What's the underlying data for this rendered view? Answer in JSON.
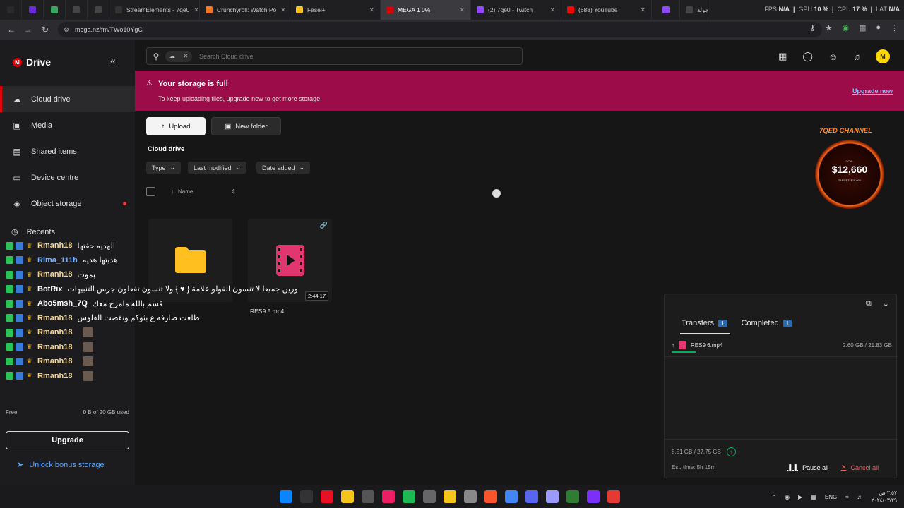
{
  "browser": {
    "tabs": [
      {
        "label": "",
        "color": "#2a2a2a"
      },
      {
        "label": "",
        "color": "#6b2bd6"
      },
      {
        "label": "",
        "color": "#3aa55c"
      },
      {
        "label": "",
        "color": "#444"
      },
      {
        "label": "",
        "color": "#444"
      },
      {
        "label": "StreamElements - 7qe0",
        "color": "#333"
      },
      {
        "label": "Crunchyroll: Watch Po",
        "color": "#f47521"
      },
      {
        "label": "Fasel+",
        "color": "#f5c518"
      },
      {
        "label": "MEGA 1 0%",
        "color": "#d90007"
      },
      {
        "label": "(2) 7qe0 - Twitch",
        "color": "#9146ff"
      },
      {
        "label": "(688) YouTube",
        "color": "#ff0000"
      },
      {
        "label": "",
        "color": "#9146ff"
      },
      {
        "label": "سرد | جولة",
        "color": "#444"
      }
    ],
    "perf": {
      "fps_label": "FPS",
      "fps": "N/A",
      "gpu_label": "GPU",
      "gpu": "10 %",
      "cpu_label": "CPU",
      "cpu": "17 %",
      "lat_label": "LAT",
      "lat": "N/A"
    },
    "url": "mega.nz/fm/TWo10YgC"
  },
  "sidebar": {
    "brand": "Drive",
    "items": [
      {
        "label": "Cloud drive",
        "icon": "cloud-icon"
      },
      {
        "label": "Media",
        "icon": "image-icon"
      },
      {
        "label": "Shared items",
        "icon": "shared-icon"
      },
      {
        "label": "Device centre",
        "icon": "monitor-icon"
      },
      {
        "label": "Object storage",
        "icon": "object-storage-icon"
      }
    ],
    "recents": "Recents",
    "storage_label": "Free",
    "storage_used": "0 B of 20 GB used",
    "upgrade": "Upgrade",
    "unlock": "Unlock bonus storage"
  },
  "chat": [
    {
      "name": "Rmanh18",
      "msg": "الهديه حقتها",
      "style": ""
    },
    {
      "name": "Rima_111h",
      "msg": "هديتها هديه",
      "style": "blue"
    },
    {
      "name": "Rmanh18",
      "msg": "بموت",
      "style": ""
    },
    {
      "name": "BotRix",
      "msg": "ورين جميعا لا تنسون الفولو علامة { ♥ } ولا تنسون تفعلون جرس التنبيهات",
      "style": "white"
    },
    {
      "name": "Abo5msh_7Q",
      "msg": "قسم بالله مامزح معك",
      "style": "white"
    },
    {
      "name": "Rmanh18",
      "msg": "طلعت صارفه ع بثوكم ونقصت الفلوس",
      "style": ""
    },
    {
      "name": "Rmanh18",
      "msg": "",
      "style": ""
    },
    {
      "name": "Rmanh18",
      "msg": "",
      "style": ""
    },
    {
      "name": "Rmanh18",
      "msg": "",
      "style": ""
    },
    {
      "name": "Rmanh18",
      "msg": "",
      "style": ""
    }
  ],
  "topbar": {
    "search_placeholder": "Search Cloud drive",
    "avatar_initial": "M"
  },
  "banner": {
    "title": "Your storage is full",
    "subtitle": "To keep uploading files, upgrade now to get more storage.",
    "cta": "Upgrade now"
  },
  "main": {
    "upload": "Upload",
    "new_folder": "New folder",
    "breadcrumb": "Cloud drive",
    "filters": [
      "Type",
      "Last modified",
      "Date added"
    ],
    "col_name": "Name",
    "files": [
      {
        "name": "",
        "type": "folder"
      },
      {
        "name": "RES9 5.mp4",
        "type": "video",
        "duration": "2:44:17"
      }
    ]
  },
  "donation": {
    "channel": "7QED CHANNEL",
    "label": "GOAL",
    "amount": "$12,660",
    "target": "TARGET: $15,000"
  },
  "transfers": {
    "tab_transfers": "Transfers",
    "tab_transfers_count": "1",
    "tab_completed": "Completed",
    "tab_completed_count": "1",
    "file_name": "RES9 6.mp4",
    "file_size": "2.60 GB / 21.83 GB",
    "progress": 0.12,
    "total": "8.51 GB / 27.75 GB",
    "est": "Est. time: 5h 15m",
    "pause": "Pause all",
    "cancel": "Cancel all"
  },
  "taskbar": {
    "lang": "ENG",
    "time": "٣:٥٧ ص",
    "date": "٢٠٢٤/٠٣/٢٩",
    "icon_colors": [
      "#0a84ff",
      "#333",
      "#e81123",
      "#f5c518",
      "#555",
      "#e91e63",
      "#1db954",
      "#666",
      "#f5c518",
      "#888",
      "#fb542b",
      "#4285f4",
      "#5865f2",
      "#9999ff",
      "#2e7d32",
      "#7b2ff7",
      "#e53935"
    ]
  }
}
